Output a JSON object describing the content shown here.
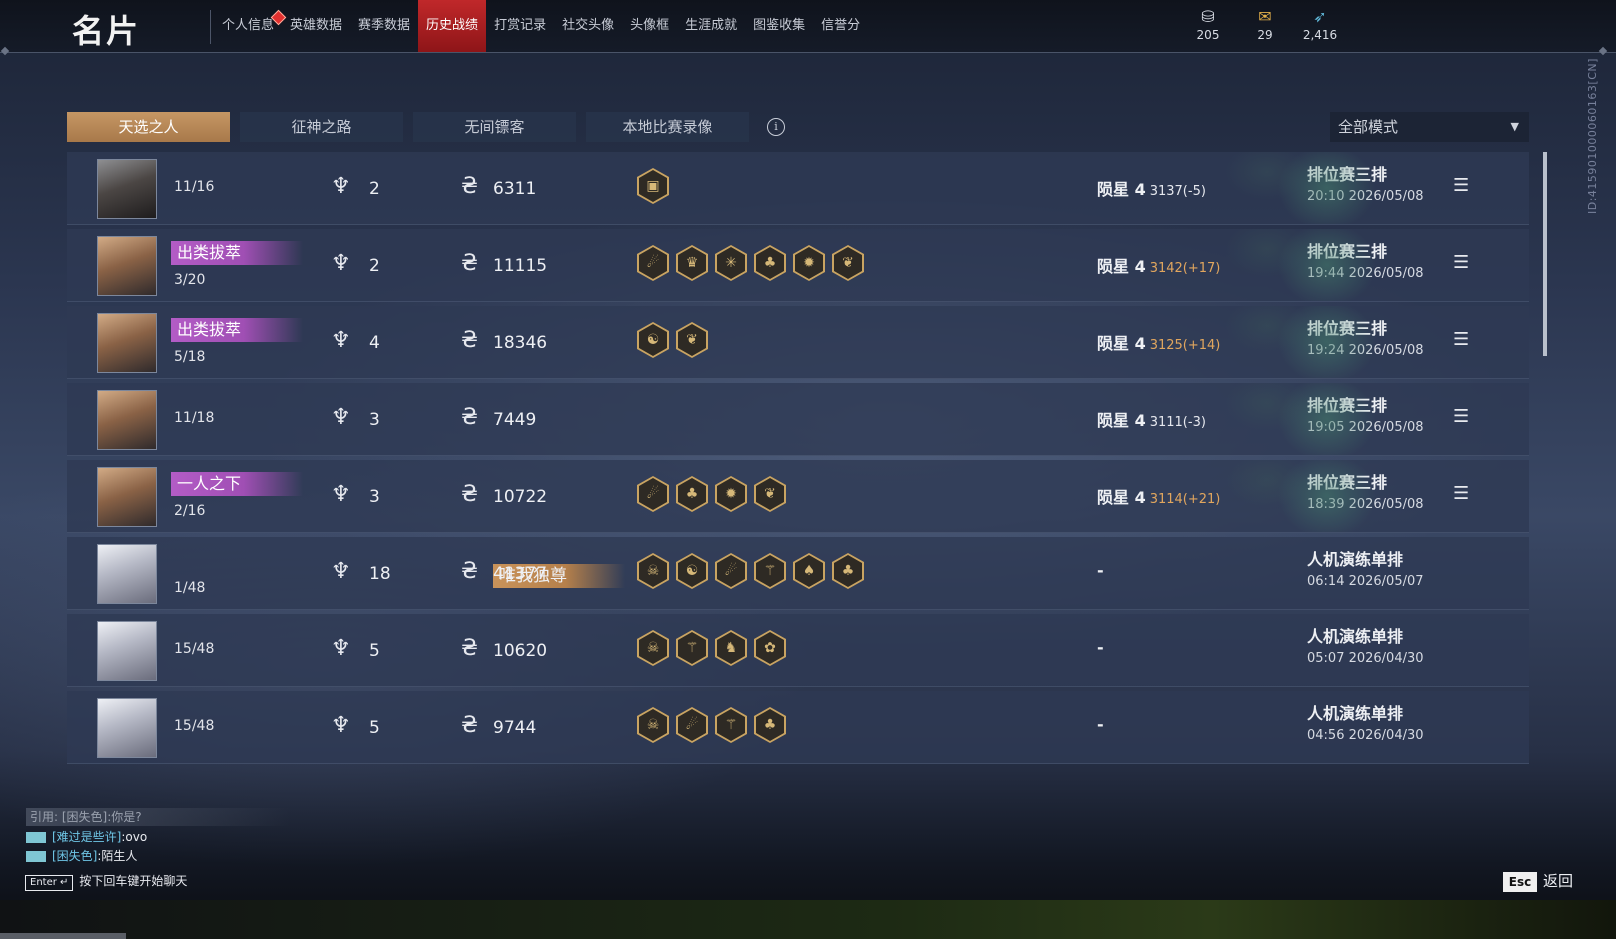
{
  "header": {
    "title": "名片",
    "tabs": [
      {
        "label": "个人信息",
        "dot": true
      },
      {
        "label": "英雄数据"
      },
      {
        "label": "赛季数据"
      },
      {
        "label": "历史战绩",
        "active": true
      },
      {
        "label": "打赏记录"
      },
      {
        "label": "社交头像"
      },
      {
        "label": "头像框"
      },
      {
        "label": "生涯成就"
      },
      {
        "label": "图鉴收集"
      },
      {
        "label": "信誉分"
      }
    ],
    "currencies": [
      {
        "icon": "coin-stack-icon",
        "value": "205"
      },
      {
        "icon": "ticket-icon",
        "value": "29"
      },
      {
        "icon": "feather-icon",
        "value": "2,416"
      }
    ]
  },
  "subtabs": [
    "天选之人",
    "征神之路",
    "无间镖客",
    "本地比赛录像"
  ],
  "active_subtab": 0,
  "mode_select": {
    "value": "全部模式"
  },
  "player_id": "ID:415901000060163[CN]",
  "rows": [
    {
      "avatar": "helmet",
      "badge": "",
      "badge_color": "",
      "place": "11/16",
      "level": "2",
      "gold": "6311",
      "augments": [
        "▣"
      ],
      "rank": "陨星 4",
      "score": "3137(-5)",
      "score_up": false,
      "mode": "排位赛三排",
      "time": "20:10  2026/05/08",
      "menu": true
    },
    {
      "avatar": "male",
      "badge": "出类拔萃",
      "badge_color": "purple",
      "place": "3/20",
      "level": "2",
      "gold": "11115",
      "augments": [
        "☄",
        "♛",
        "✳",
        "♣",
        "✹",
        "❦"
      ],
      "rank": "陨星 4",
      "score": "3142(+17)",
      "score_up": true,
      "mode": "排位赛三排",
      "time": "19:44  2026/05/08",
      "menu": true
    },
    {
      "avatar": "male",
      "badge": "出类拔萃",
      "badge_color": "purple",
      "place": "5/18",
      "level": "4",
      "gold": "18346",
      "augments": [
        "☯",
        "❦"
      ],
      "rank": "陨星 4",
      "score": "3125(+14)",
      "score_up": true,
      "mode": "排位赛三排",
      "time": "19:24  2026/05/08",
      "menu": true
    },
    {
      "avatar": "male",
      "badge": "",
      "badge_color": "",
      "place": "11/18",
      "level": "3",
      "gold": "7449",
      "augments": [],
      "rank": "陨星 4",
      "score": "3111(-3)",
      "score_up": false,
      "mode": "排位赛三排",
      "time": "19:05  2026/05/08",
      "menu": true
    },
    {
      "avatar": "male",
      "badge": "一人之下",
      "badge_color": "purple",
      "place": "2/16",
      "level": "3",
      "gold": "10722",
      "augments": [
        "☄",
        "♣",
        "✹",
        "❦"
      ],
      "rank": "陨星 4",
      "score": "3114(+21)",
      "score_up": true,
      "mode": "排位赛三排",
      "time": "18:39  2026/05/08",
      "menu": true
    },
    {
      "avatar": "female",
      "badge": "唯我独尊",
      "badge_color": "gold",
      "place": "1/48",
      "level": "18",
      "gold": "41377",
      "augments": [
        "☠",
        "☯",
        "☄",
        "⚚",
        "♠",
        "♣"
      ],
      "rank": "-",
      "score": "",
      "score_up": false,
      "mode": "人机演练单排",
      "time": "06:14  2026/05/07",
      "menu": false
    },
    {
      "avatar": "female",
      "badge": "",
      "badge_color": "",
      "place": "15/48",
      "level": "5",
      "gold": "10620",
      "augments": [
        "☠",
        "⚚",
        "♞",
        "✿"
      ],
      "rank": "-",
      "score": "",
      "score_up": false,
      "mode": "人机演练单排",
      "time": "05:07  2026/04/30",
      "menu": false
    },
    {
      "avatar": "female",
      "badge": "",
      "badge_color": "",
      "place": "15/48",
      "level": "5",
      "gold": "9744",
      "augments": [
        "☠",
        "☄",
        "⚚",
        "♣"
      ],
      "rank": "-",
      "score": "",
      "score_up": false,
      "mode": "人机演练单排",
      "time": "04:56  2026/04/30",
      "menu": false
    }
  ],
  "chat": {
    "quote": "引用: [困失色]:你是?",
    "messages": [
      {
        "name": "[难过是些许]",
        "text": ":ovo"
      },
      {
        "name": "[困失色]",
        "text": ":陌生人"
      }
    ],
    "enter_key": "Enter ↵",
    "hint": "按下回车键开始聊天"
  },
  "back": {
    "key": "Esc",
    "label": "返回"
  }
}
